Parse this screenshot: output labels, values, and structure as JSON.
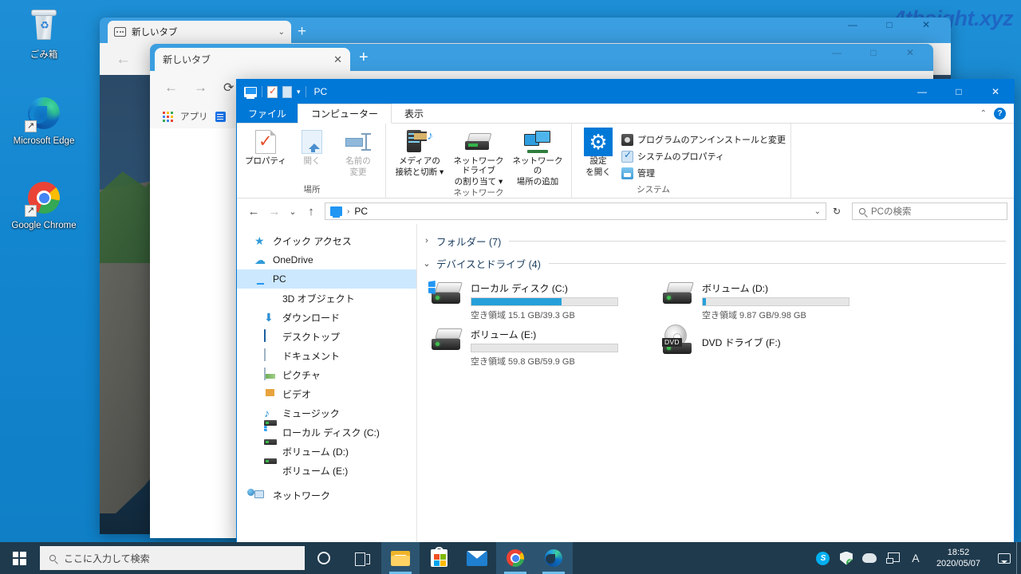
{
  "desktop": {
    "watermark": "4thsight.xyz",
    "icons": [
      {
        "label": "ごみ箱",
        "icon": "recycle-bin-icon"
      },
      {
        "label": "Microsoft Edge",
        "icon": "microsoft-edge-icon"
      },
      {
        "label": "Google Chrome",
        "icon": "google-chrome-icon"
      }
    ]
  },
  "edge_window": {
    "tab_title": "新しいタブ",
    "new_tab_label": "+",
    "chevron": "⌄",
    "back_arrow": "←",
    "minimize": "—",
    "maximize": "□",
    "close": "✕"
  },
  "chrome_window": {
    "tab_title": "新しいタブ",
    "close_tab": "✕",
    "new_tab_label": "+",
    "back_arrow": "←",
    "forward_arrow": "→",
    "reload_arrow": "⟳",
    "bookmark_apps_label": "アプリ",
    "minimize": "—",
    "maximize": "□",
    "close": "✕"
  },
  "explorer": {
    "title": "PC",
    "quick_access_toolbar": [
      {
        "name": "pc-icon"
      },
      {
        "name": "properties-icon"
      },
      {
        "name": "new-folder-icon"
      },
      {
        "name": "customize-caret"
      }
    ],
    "window_controls": {
      "minimize": "—",
      "maximize": "□",
      "close": "✕"
    },
    "ribbon_tabs": [
      {
        "label": "ファイル",
        "type": "file"
      },
      {
        "label": "コンピューター",
        "type": "active"
      },
      {
        "label": "表示",
        "type": "normal"
      }
    ],
    "ribbon_collapse": "⌃",
    "help_label": "?",
    "ribbon_groups": [
      {
        "name": "場所",
        "buttons": [
          {
            "label": "プロパティ",
            "icon": "properties-icon",
            "disabled": false
          },
          {
            "label": "開く",
            "icon": "open-icon",
            "disabled": true
          },
          {
            "label": "名前の\n変更",
            "line1": "名前の",
            "line2": "変更",
            "icon": "rename-icon",
            "disabled": true
          }
        ]
      },
      {
        "name": "ネットワーク",
        "buttons": [
          {
            "line1": "メディアの",
            "line2": "接続と切断 ▾",
            "icon": "media-icon"
          },
          {
            "line1": "ネットワーク ドライブ",
            "line2": "の割り当て ▾",
            "icon": "map-network-drive-icon"
          },
          {
            "line1": "ネットワークの",
            "line2": "場所の追加",
            "icon": "add-network-location-icon"
          }
        ]
      },
      {
        "name": "システム",
        "big_button": {
          "line1": "設定",
          "line2": "を開く",
          "icon": "settings-gear-icon"
        },
        "items": [
          {
            "label": "プログラムのアンインストールと変更",
            "icon": "uninstall-program-icon"
          },
          {
            "label": "システムのプロパティ",
            "icon": "system-properties-icon"
          },
          {
            "label": "管理",
            "icon": "manage-icon"
          }
        ]
      }
    ],
    "address_bar": {
      "back": "←",
      "forward": "→",
      "recent": "⌄",
      "up": "↑",
      "crumb_icon": "pc-icon",
      "crumb_separator": "›",
      "crumb_text": "PC",
      "dropdown": "⌄",
      "refresh": "↻",
      "search_placeholder": "PCの検索",
      "search_value": ""
    },
    "nav_pane": [
      {
        "label": "クイック アクセス",
        "icon": "quick-access-star-icon",
        "level": 1,
        "selected": false
      },
      {
        "label": "OneDrive",
        "icon": "onedrive-cloud-icon",
        "level": 1,
        "selected": false
      },
      {
        "label": "PC",
        "icon": "pc-icon",
        "level": 1,
        "selected": true
      },
      {
        "label": "3D オブジェクト",
        "icon": "3d-objects-icon",
        "level": 2,
        "selected": false
      },
      {
        "label": "ダウンロード",
        "icon": "downloads-icon",
        "level": 2,
        "selected": false
      },
      {
        "label": "デスクトップ",
        "icon": "desktop-icon",
        "level": 2,
        "selected": false
      },
      {
        "label": "ドキュメント",
        "icon": "documents-icon",
        "level": 2,
        "selected": false
      },
      {
        "label": "ピクチャ",
        "icon": "pictures-icon",
        "level": 2,
        "selected": false
      },
      {
        "label": "ビデオ",
        "icon": "videos-icon",
        "level": 2,
        "selected": false
      },
      {
        "label": "ミュージック",
        "icon": "music-icon",
        "level": 2,
        "selected": false
      },
      {
        "label": "ローカル ディスク (C:)",
        "icon": "local-disk-icon",
        "level": 2,
        "selected": false
      },
      {
        "label": "ボリューム (D:)",
        "icon": "volume-icon",
        "level": 2,
        "selected": false
      },
      {
        "label": "ボリューム (E:)",
        "icon": "volume-icon",
        "level": 2,
        "selected": false
      },
      {
        "label": "ネットワーク",
        "icon": "network-icon",
        "level": 1,
        "selected": false
      }
    ],
    "groups": [
      {
        "label": "フォルダー (7)",
        "expanded": false,
        "chevron": "›"
      },
      {
        "label": "デバイスとドライブ (4)",
        "expanded": true,
        "chevron": "⌄"
      }
    ],
    "drives": [
      {
        "name": "ローカル ディスク (C:)",
        "free_text": "空き領域 15.1 GB/39.3 GB",
        "free_gb": 15.1,
        "total_gb": 39.3,
        "used_percent": 62,
        "icon": "windows-drive-icon",
        "has_bar": true
      },
      {
        "name": "ボリューム (D:)",
        "free_text": "空き領域 9.87 GB/9.98 GB",
        "free_gb": 9.87,
        "total_gb": 9.98,
        "used_percent": 2,
        "icon": "drive-icon",
        "has_bar": true
      },
      {
        "name": "ボリューム (E:)",
        "free_text": "空き領域 59.8 GB/59.9 GB",
        "free_gb": 59.8,
        "total_gb": 59.9,
        "used_percent": 0,
        "icon": "drive-icon",
        "has_bar": true
      },
      {
        "name": "DVD ドライブ (F:)",
        "free_text": "",
        "icon": "dvd-drive-icon",
        "badge": "DVD",
        "has_bar": false
      }
    ]
  },
  "taskbar": {
    "start_label": "start-icon",
    "search_placeholder": "ここに入力して検索",
    "pinned": [
      {
        "name": "cortana-icon",
        "active": false
      },
      {
        "name": "task-view-icon",
        "active": false
      },
      {
        "name": "file-explorer-icon",
        "active": true
      },
      {
        "name": "microsoft-store-icon",
        "active": false
      },
      {
        "name": "mail-icon",
        "active": false
      },
      {
        "name": "google-chrome-icon",
        "active": true
      },
      {
        "name": "microsoft-edge-icon",
        "active": true
      }
    ],
    "tray": [
      {
        "name": "skype-icon",
        "glyph": "S"
      },
      {
        "name": "windows-security-icon"
      },
      {
        "name": "onedrive-icon"
      },
      {
        "name": "network-icon"
      },
      {
        "name": "ime-icon",
        "glyph": "A"
      }
    ],
    "clock": {
      "time": "18:52",
      "date": "2020/05/07"
    },
    "action_center": "action-center-icon"
  },
  "colors": {
    "accent": "#0078d7",
    "desktop_blue": "#1386d0",
    "taskbar": "#1f3a4d",
    "selection": "#cce8ff",
    "progress_blue": "#26a0da"
  }
}
